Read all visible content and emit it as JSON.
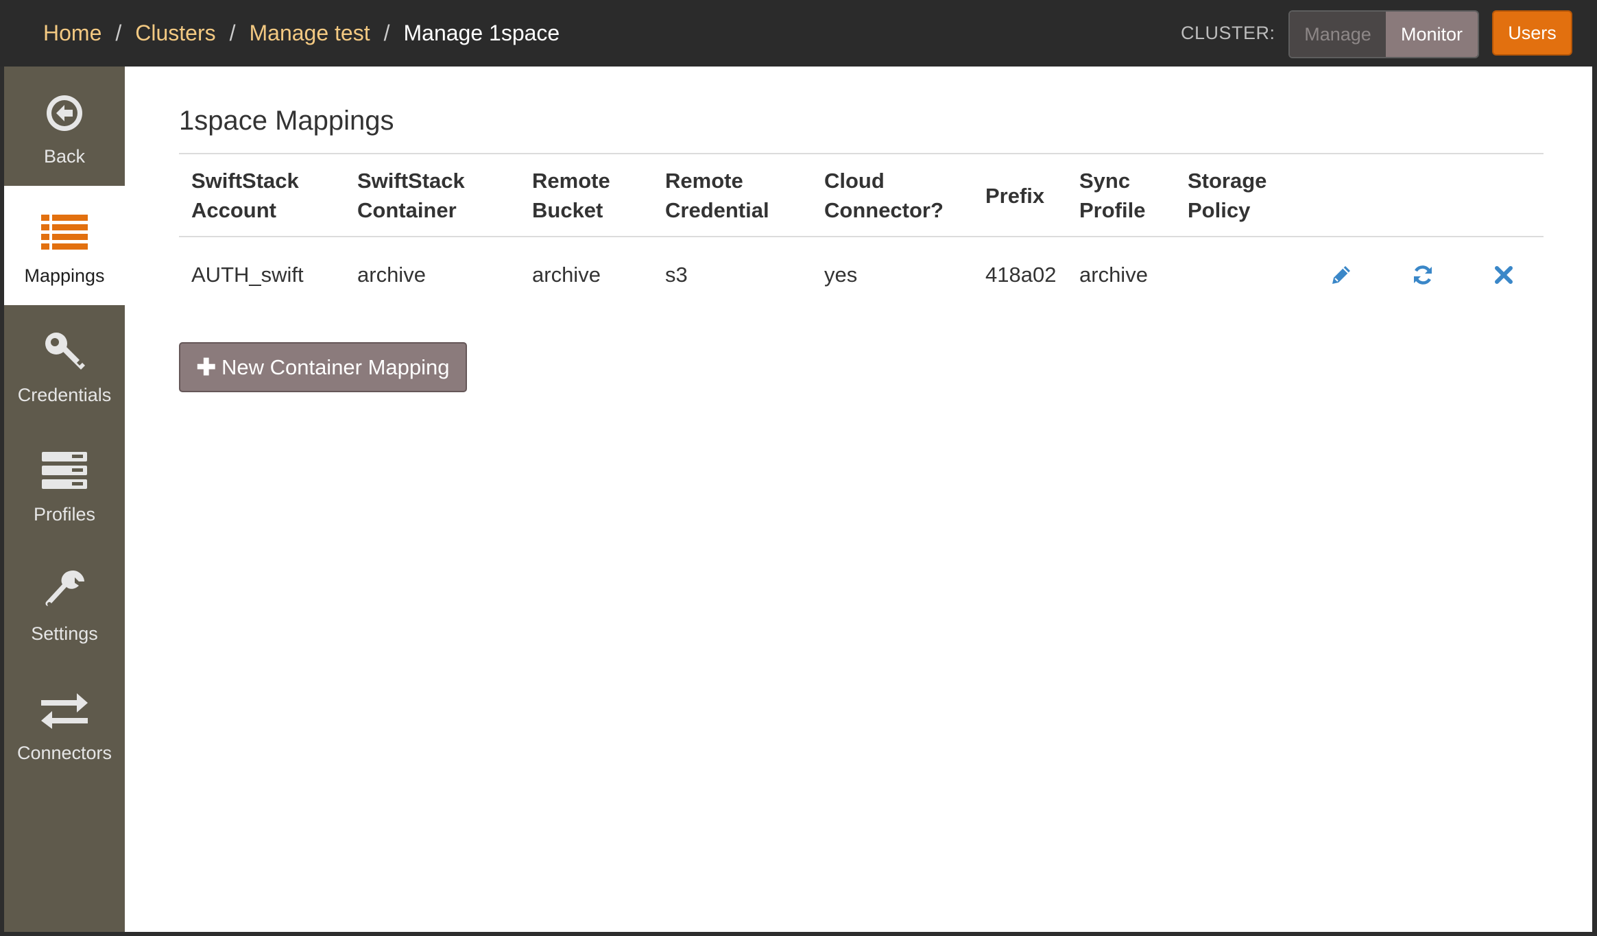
{
  "breadcrumb": {
    "home": "Home",
    "clusters": "Clusters",
    "manage_test": "Manage test",
    "current": "Manage 1space",
    "separator": "/"
  },
  "header": {
    "cluster_label": "CLUSTER:",
    "manage_label": "Manage",
    "monitor_label": "Monitor",
    "users_label": "Users"
  },
  "sidebar": {
    "items": [
      {
        "label": "Back",
        "icon": "back-arrow-circle-icon"
      },
      {
        "label": "Mappings",
        "icon": "list-icon",
        "active": true
      },
      {
        "label": "Credentials",
        "icon": "key-icon"
      },
      {
        "label": "Profiles",
        "icon": "server-icon"
      },
      {
        "label": "Settings",
        "icon": "wrench-icon"
      },
      {
        "label": "Connectors",
        "icon": "exchange-arrows-icon"
      }
    ]
  },
  "main": {
    "title": "1space Mappings",
    "table": {
      "headers": [
        [
          "SwiftStack",
          "Account"
        ],
        [
          "SwiftStack",
          "Container"
        ],
        [
          "Remote",
          "Bucket"
        ],
        [
          "Remote",
          "Credential"
        ],
        [
          "Cloud",
          "Connector?"
        ],
        [
          "Prefix"
        ],
        [
          "Sync",
          "Profile"
        ],
        [
          "Storage",
          "Policy"
        ]
      ],
      "rows": [
        {
          "account": "AUTH_swift",
          "container": "archive",
          "bucket": "archive",
          "credential": "s3",
          "cloud_connector": "yes",
          "prefix": "418a02",
          "sync_profile": "archive",
          "storage_policy": ""
        }
      ]
    },
    "new_button_label": "New Container Mapping"
  },
  "colors": {
    "accent_orange": "#e2700f",
    "link": "#f3c982",
    "action_blue": "#3a87c8",
    "sidebar_bg": "#5f5a4c",
    "navbar_bg": "#2b2b2b"
  }
}
